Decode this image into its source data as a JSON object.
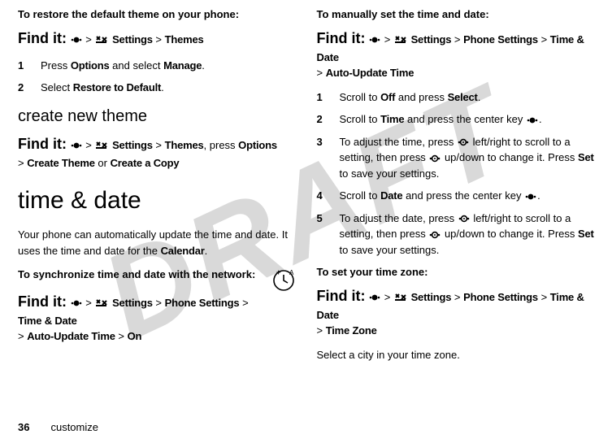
{
  "watermark": "DRAFT",
  "left": {
    "restore_heading_pre": "To restore the default theme on your phone",
    "findit_label": "Find it:",
    "settings": "Settings",
    "themes": "Themes",
    "step1_a": "Press ",
    "step1_b": "Options",
    "step1_c": " and select ",
    "step1_d": "Manage",
    "step1_e": ".",
    "step2_a": "Select ",
    "step2_b": "Restore to Default",
    "step2_c": ".",
    "create_heading": "create new theme",
    "create_tail_a": ", press ",
    "create_tail_b": "Options",
    "create_theme": "Create Theme",
    "or": " or ",
    "create_copy": "Create a Copy",
    "timedate_heading": "time & date",
    "timedate_para_a": "Your phone can automatically update the time and date. It uses the time and date for the ",
    "timedate_para_b": "Calendar",
    "timedate_para_c": ".",
    "sync_heading": "To synchronize time and date with the network",
    "phone_settings": "Phone Settings",
    "time_and_date": "Time & Date",
    "auto_update_time": "Auto-Update Time",
    "on": "On"
  },
  "right": {
    "manual_heading": "To manually set the time and date",
    "findit_label": "Find it:",
    "settings": "Settings",
    "phone_settings": "Phone Settings",
    "time_and_date": "Time & Date",
    "auto_update_time": "Auto-Update Time",
    "step1_a": "Scroll to ",
    "step1_b": "Off",
    "step1_c": " and press ",
    "step1_d": "Select",
    "step1_e": ".",
    "step2_a": "Scroll to ",
    "step2_b": "Time",
    "step2_c": " and press the center key ",
    "step2_d": ".",
    "step3_a": "To adjust the time, press ",
    "step3_b": " left/right to scroll to a setting, then press ",
    "step3_c": " up/down to change it. Press ",
    "step3_d": "Set",
    "step3_e": " to save your settings.",
    "step4_a": "Scroll to ",
    "step4_b": "Date",
    "step4_c": " and press the center key ",
    "step4_d": ".",
    "step5_a": "To adjust the date, press ",
    "step5_b": " left/right to scroll to a setting, then press ",
    "step5_c": " up/down to change it. Press ",
    "step5_d": "Set",
    "step5_e": " to save your settings.",
    "tz_heading": "To set your time zone",
    "time_zone": "Time Zone",
    "tz_para": "Select a city in your time zone."
  },
  "footer": {
    "page": "36",
    "section": "customize"
  },
  "sep": ">"
}
